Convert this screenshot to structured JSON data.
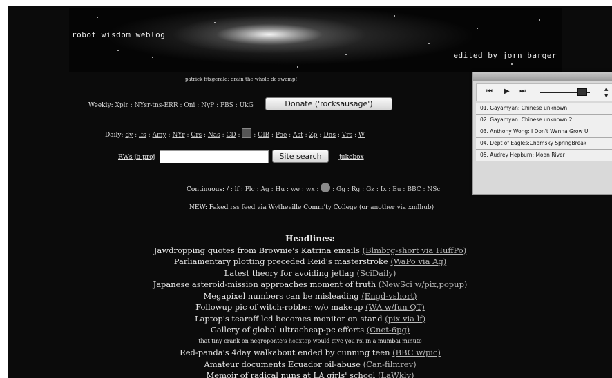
{
  "header": {
    "site_title": "robot wisdom weblog",
    "editor": "edited by jorn barger",
    "tagline": "patrick fitzgerald: drain the whole dc swamp!"
  },
  "weekly": {
    "label": "Weekly:",
    "links": [
      "Xplr",
      "NYsr-tns-ERR",
      "Oni",
      "NyP",
      "PBS",
      "UkG"
    ],
    "donate_label": "Donate ('rocksausage')"
  },
  "daily": {
    "label": "Daily:",
    "links_before_icon": [
      "dy",
      "lfs",
      "Amy",
      "NYr",
      "Crs",
      "Nas",
      "CD"
    ],
    "links_after_icon": [
      "OlB",
      "Poe",
      "Ast",
      "Zp",
      "Dns",
      "Vrs",
      "W"
    ]
  },
  "search": {
    "left_link": "RWs-jb-proj",
    "input_value": "",
    "button_label": "Site search",
    "right_link": "jukebox"
  },
  "continuous": {
    "label": "Continuous:",
    "links_before_icon": [
      "/",
      "lf",
      "Plc",
      "Ag",
      "Hu",
      "we",
      "wx"
    ],
    "links_after_icon": [
      "Gg",
      "Rg",
      "Gz",
      "Ix",
      "Eu",
      "BBC",
      "NSc"
    ]
  },
  "news": {
    "prefix": "NEW: Faked",
    "link1": "rss feed",
    "middle": "via Wytheville Comm'ty College (or",
    "link2": "another",
    "via": "via",
    "link3": "xmlhub",
    "suffix": ")"
  },
  "headlines": {
    "title": "Headlines:",
    "items": [
      {
        "text": "Jawdropping quotes from Brownie's Katrina emails",
        "link": "(Blmbrg-short via HuffPo)"
      },
      {
        "text": "Parliamentary plotting preceded Reid's masterstroke",
        "link": "(WaPo via Ag)"
      },
      {
        "text": "Latest theory for avoiding jetlag",
        "link": "(SciDaily)"
      },
      {
        "text": "Japanese asteroid-mission approaches moment of truth",
        "link": "(NewSci w/pix,popup)"
      },
      {
        "text": "Megapixel numbers can be misleading",
        "link": "(Engd-vshort)"
      },
      {
        "text": "Followup pic of witch-robber w/o makeup",
        "link": "(WA w/fun QT)"
      },
      {
        "text": "Laptop's tearoff lcd becomes monitor on stand",
        "link": "(pix via lf)"
      },
      {
        "text": "Gallery of global ultracheap-pc efforts",
        "link": "(Cnet-6pg)"
      },
      {
        "text": "Red-panda's 4day walkabout ended by cunning teen",
        "link": "(BBC w/pic)"
      },
      {
        "text": "Amateur documents Ecuador oil-abuse",
        "link": "(Can-filmrev)"
      },
      {
        "text": "Memoir of radical nuns at LA girls' school",
        "link": "(LaWkly)"
      }
    ],
    "small_item": {
      "before": "that tiny crank on negroponte's",
      "link": "hoaxtop",
      "after": "would give you rsi in a mumbai minute"
    }
  },
  "player": {
    "tracks": [
      "01. Gayamyan: Chinese unknown",
      "02. Gayamyan: Chinese unknown 2",
      "03. Anthony Wong: I Don't Wanna Grow U",
      "04. Dept of Eagles:Chomsky SpringBreak",
      "05. Audrey Hepburn: Moon River"
    ],
    "volume_fraction": 0.85
  },
  "icons": {
    "prev": "⏮",
    "play": "▶",
    "next": "⏭",
    "scroll_up": "▲",
    "scroll_down": "▼"
  }
}
